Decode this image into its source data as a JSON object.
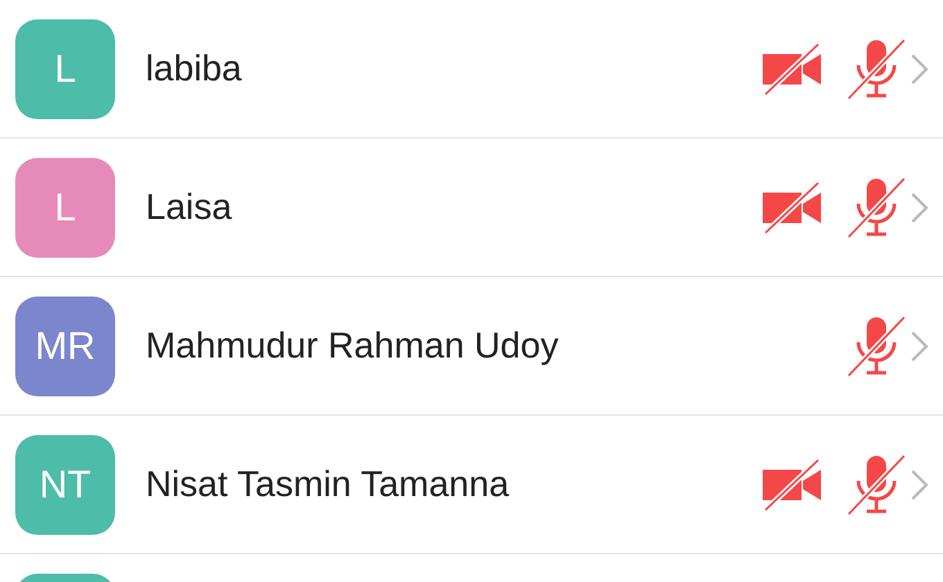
{
  "participants": [
    {
      "initials": "L",
      "name": "labiba",
      "color": "#4dbca9",
      "video_off": true,
      "mic_off": true
    },
    {
      "initials": "L",
      "name": "Laisa",
      "color": "#e68bb9",
      "video_off": true,
      "mic_off": true
    },
    {
      "initials": "MR",
      "name": "Mahmudur Rahman Udoy",
      "color": "#7b86cc",
      "video_off": false,
      "mic_off": true
    },
    {
      "initials": "NT",
      "name": "Nisat Tasmin Tamanna",
      "color": "#4dbca9",
      "video_off": true,
      "mic_off": true
    },
    {
      "color": "#4dbca9"
    }
  ]
}
